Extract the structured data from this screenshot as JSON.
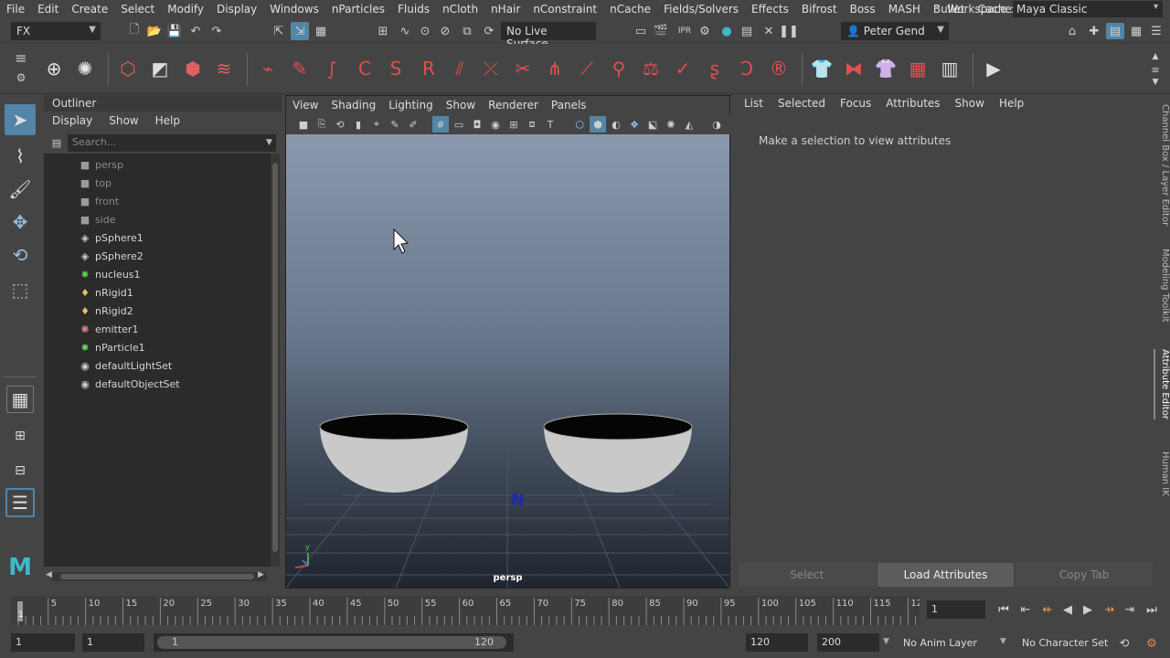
{
  "menubar": {
    "items": [
      "File",
      "Edit",
      "Create",
      "Select",
      "Modify",
      "Display",
      "Windows",
      "nParticles",
      "Fluids",
      "nCloth",
      "nHair",
      "nConstraint",
      "nCache",
      "Fields/Solvers",
      "Effects",
      "Bifrost",
      "Boss",
      "MASH",
      "Bullet",
      "Cache"
    ],
    "workspace_label": "Workspace :",
    "workspace_value": "Maya Classic"
  },
  "statusline": {
    "menuset": "FX",
    "live_surface": "No Live Surface",
    "user": "Peter Gend"
  },
  "outliner": {
    "title": "Outliner",
    "menu": [
      "Display",
      "Show",
      "Help"
    ],
    "search_placeholder": "Search...",
    "items": [
      {
        "label": "persp",
        "icon": "camera-icon",
        "dim": true
      },
      {
        "label": "top",
        "icon": "camera-icon",
        "dim": true
      },
      {
        "label": "front",
        "icon": "camera-icon",
        "dim": true
      },
      {
        "label": "side",
        "icon": "camera-icon",
        "dim": true
      },
      {
        "label": "pSphere1",
        "icon": "mesh-icon",
        "dim": false
      },
      {
        "label": "pSphere2",
        "icon": "mesh-icon",
        "dim": false
      },
      {
        "label": "nucleus1",
        "icon": "nucleus-icon",
        "dim": false
      },
      {
        "label": "nRigid1",
        "icon": "nrigid-icon",
        "dim": false
      },
      {
        "label": "nRigid2",
        "icon": "nrigid-icon",
        "dim": false
      },
      {
        "label": "emitter1",
        "icon": "emitter-icon",
        "dim": false
      },
      {
        "label": "nParticle1",
        "icon": "nparticle-icon",
        "dim": false
      },
      {
        "label": "defaultLightSet",
        "icon": "set-icon",
        "dim": false
      },
      {
        "label": "defaultObjectSet",
        "icon": "set-icon",
        "dim": false
      }
    ]
  },
  "viewport": {
    "menu": [
      "View",
      "Shading",
      "Lighting",
      "Show",
      "Renderer",
      "Panels"
    ],
    "camera": "persp",
    "axis_y": "y",
    "marker": "N"
  },
  "attribute_editor": {
    "menu": [
      "List",
      "Selected",
      "Focus",
      "Attributes",
      "Show",
      "Help"
    ],
    "message": "Make a selection to view attributes",
    "buttons": {
      "select": "Select",
      "load": "Load Attributes",
      "copy": "Copy Tab"
    }
  },
  "side_tabs": [
    "Channel Box / Layer Editor",
    "Modeling Toolkit",
    "Attribute Editor",
    "Human IK"
  ],
  "timeline": {
    "ticks": [
      "5",
      "10",
      "15",
      "20",
      "25",
      "30",
      "35",
      "40",
      "45",
      "50",
      "55",
      "60",
      "65",
      "70",
      "75",
      "80",
      "85",
      "90",
      "95",
      "100",
      "105",
      "110",
      "115",
      "12"
    ],
    "start_frame": "1",
    "current_frame": "1"
  },
  "range": {
    "start": "1",
    "playback_start": "1",
    "slider_start": "1",
    "slider_end": "120",
    "playback_end": "120",
    "end": "200",
    "anim_layer": "No Anim Layer",
    "character_set": "No Character Set"
  },
  "colors": {
    "accent": "#5285a6",
    "shelf_red": "#e05050"
  }
}
